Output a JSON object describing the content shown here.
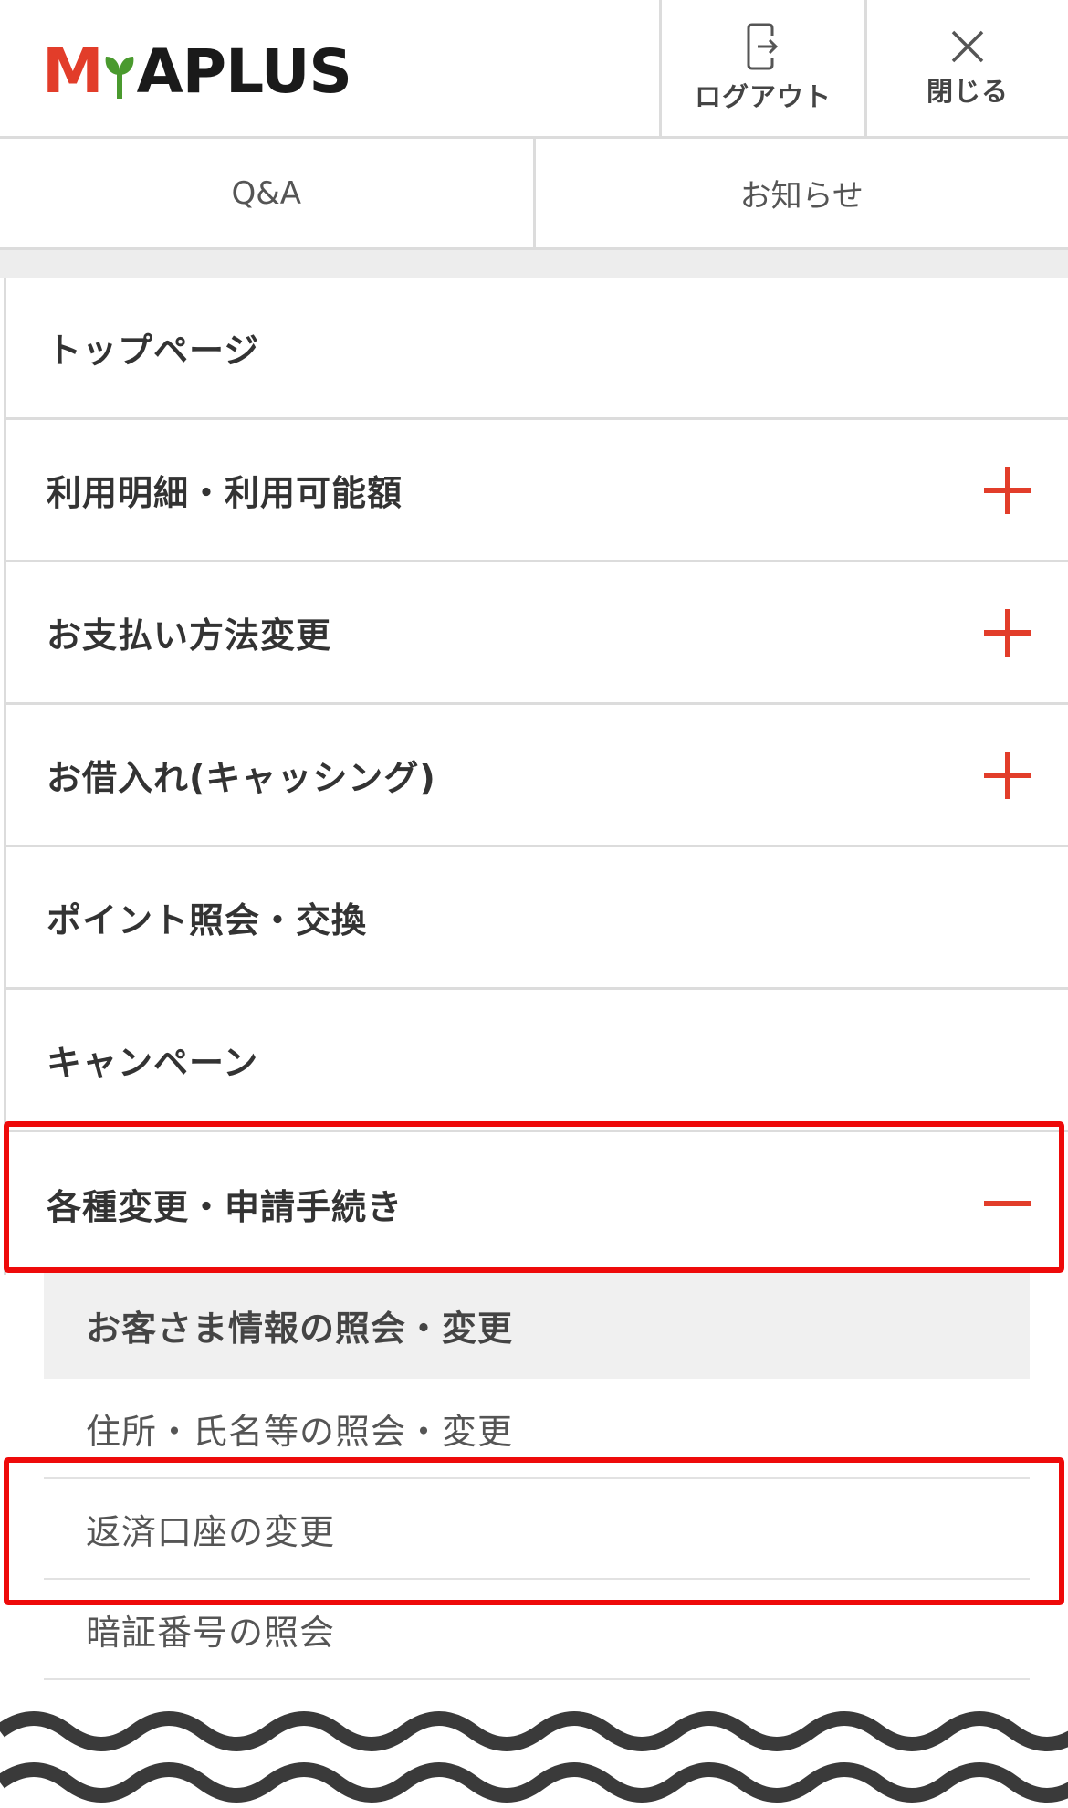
{
  "brand": {
    "logo_m": "M",
    "logo_rest": "APLUS",
    "red": "#e23d2a",
    "green": "#4a9a2e"
  },
  "header": {
    "logout_label": "ログアウト",
    "logout_icon": "logout-icon",
    "close_label": "閉じる",
    "close_icon": "close-icon"
  },
  "tabs": [
    {
      "label": "Q&A"
    },
    {
      "label": "お知らせ"
    }
  ],
  "menu": [
    {
      "label": "トップページ",
      "toggle": "none"
    },
    {
      "label": "利用明細・利用可能額",
      "toggle": "plus"
    },
    {
      "label": "お支払い方法変更",
      "toggle": "plus"
    },
    {
      "label": "お借入れ(キャッシング)",
      "toggle": "plus"
    },
    {
      "label": "ポイント照会・交換",
      "toggle": "none"
    },
    {
      "label": "キャンペーン",
      "toggle": "none"
    },
    {
      "label": "各種変更・申請手続き",
      "toggle": "minus",
      "highlighted": true
    }
  ],
  "submenu": {
    "heading": "お客さま情報の照会・変更",
    "items": [
      {
        "label": "住所・氏名等の照会・変更"
      },
      {
        "label": "返済口座の変更",
        "highlighted": true
      },
      {
        "label": "暗証番号の照会"
      }
    ]
  },
  "highlight_color": "#ee0a0a"
}
